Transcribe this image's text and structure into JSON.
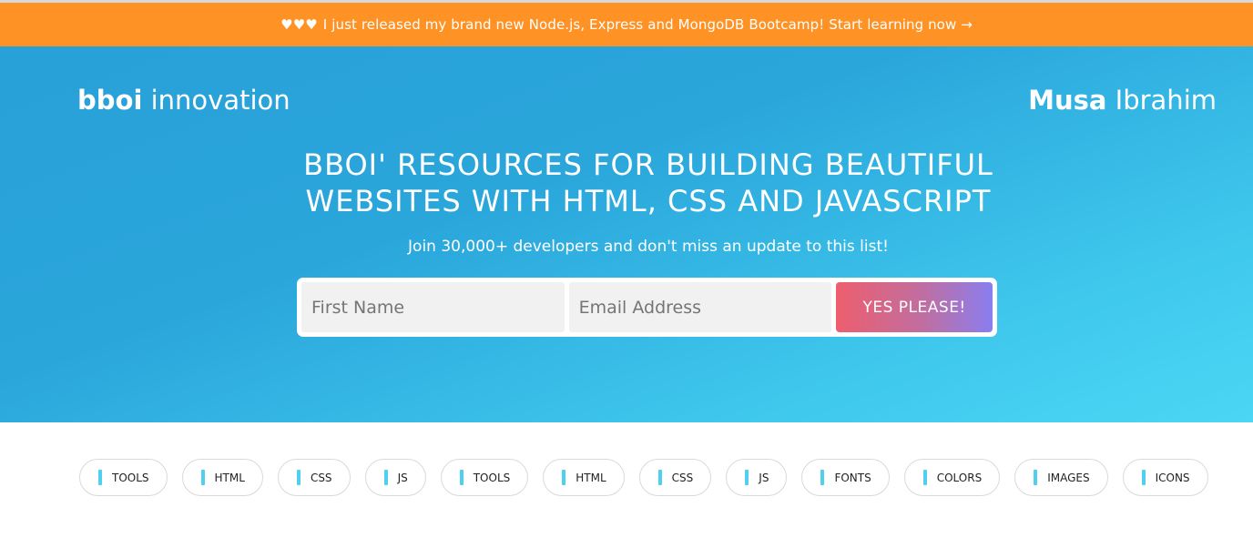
{
  "announcement": {
    "hearts": "♥♥♥",
    "text": "I just released my brand new Node.js, Express and MongoDB Bootcamp! Start learning now →"
  },
  "header": {
    "brand_bold": "bboi",
    "brand_light": "innovation",
    "author_bold": "Musa",
    "author_light": "Ibrahim"
  },
  "hero": {
    "headline_line1": "BBOI' RESOURCES FOR BUILDING BEAUTIFUL",
    "headline_line2": "WEBSITES WITH HTML, CSS AND JAVASCRIPT",
    "subline": "Join 30,000+ developers and don't miss an update to this list!"
  },
  "signup": {
    "first_name_placeholder": "First Name",
    "email_placeholder": "Email Address",
    "submit_label": "YES PLEASE!"
  },
  "tags": [
    "TOOLS",
    "HTML",
    "CSS",
    "JS",
    "TOOLS",
    "HTML",
    "CSS",
    "JS",
    "FONTS",
    "COLORS",
    "IMAGES",
    "ICONS"
  ],
  "colors": {
    "announcement_bg": "#ff9224",
    "hero_start": "#28a0d8",
    "hero_end": "#4bd6f4",
    "button_start": "#ee5e6e",
    "button_end": "#8a7ef0",
    "tag_accent": "#4fd0ee"
  }
}
